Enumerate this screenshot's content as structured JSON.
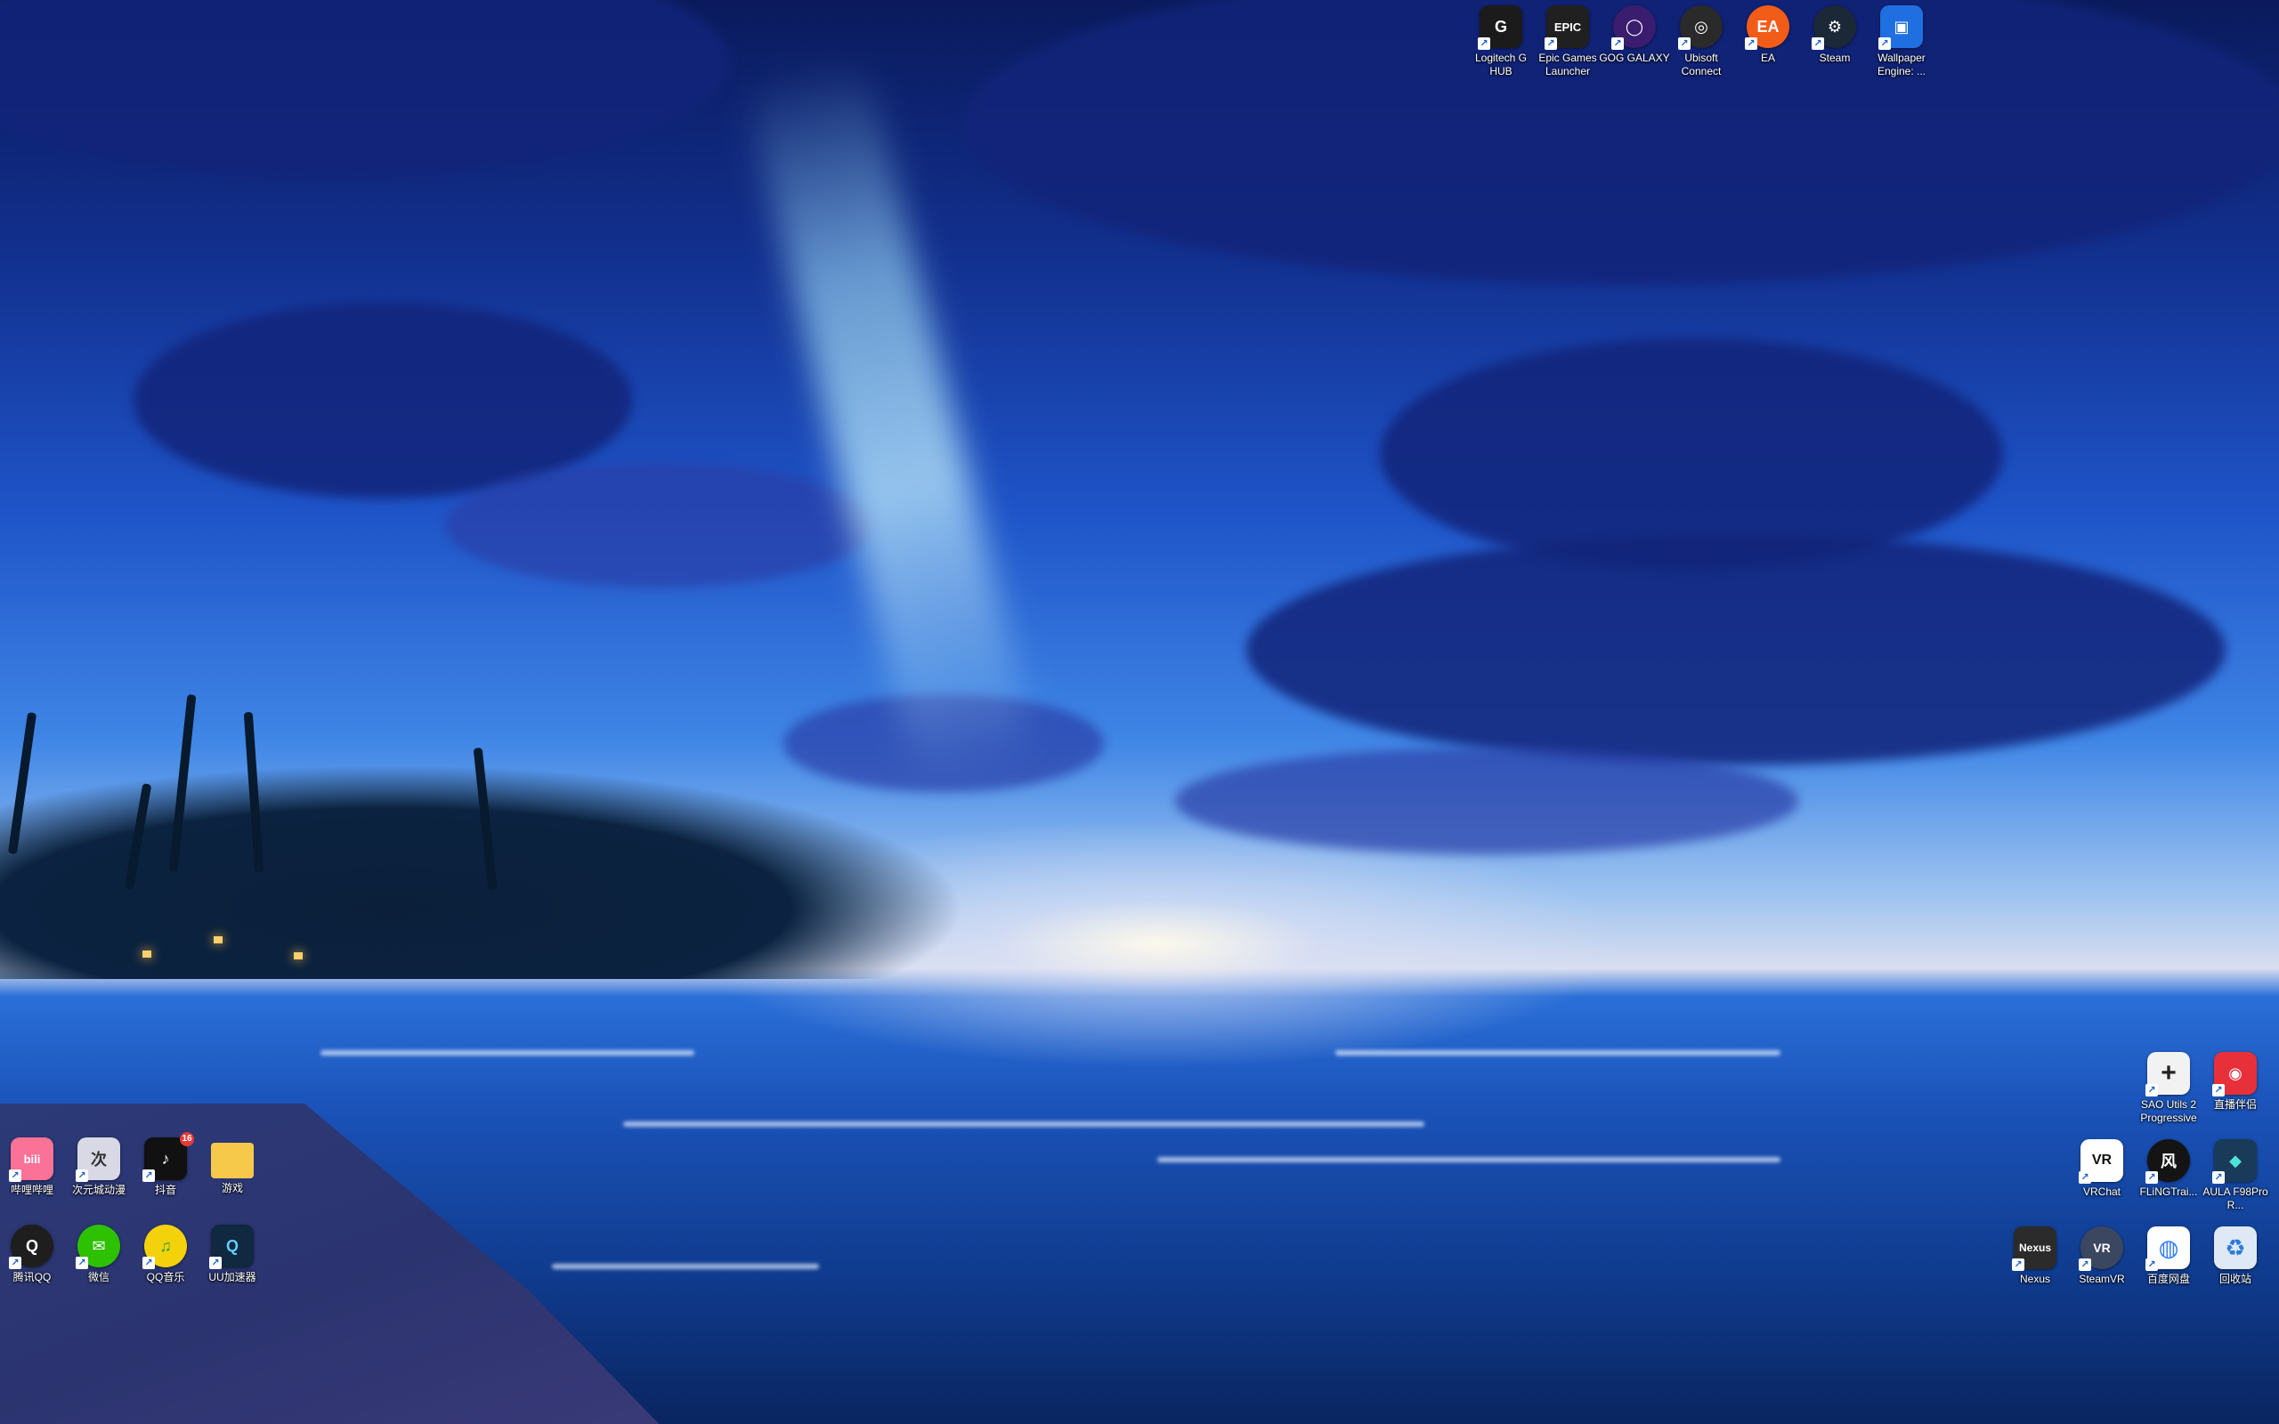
{
  "desktop": {
    "top_icons": [
      {
        "label": "Logitech G HUB",
        "glyph": "G",
        "color": "#1b1b1b",
        "icon": "logitech-g-hub-icon"
      },
      {
        "label": "Epic Games Launcher",
        "glyph": "EPIC",
        "color": "#202020",
        "icon": "epic-games-icon"
      },
      {
        "label": "GOG GALAXY",
        "glyph": "◯",
        "color": "#3a1d6e",
        "icon": "gog-galaxy-icon"
      },
      {
        "label": "Ubisoft Connect",
        "glyph": "◎",
        "color": "#2a2a2a",
        "icon": "ubisoft-connect-icon"
      },
      {
        "label": "EA",
        "glyph": "EA",
        "color": "#f25c19",
        "icon": "ea-icon"
      },
      {
        "label": "Steam",
        "glyph": "⚙",
        "color": "#1b2838",
        "icon": "steam-icon"
      },
      {
        "label": "Wallpaper Engine: ...",
        "glyph": "▣",
        "color": "#1f6fe0",
        "icon": "wallpaper-engine-icon"
      }
    ],
    "left_icons_row1": [
      {
        "label": "哔哩哔哩",
        "glyph": "bili",
        "color": "#fb7299",
        "icon": "bilibili-icon"
      },
      {
        "label": "次元城动漫",
        "glyph": "次",
        "color": "#d9d9e6",
        "icon": "ciyuancheng-icon"
      },
      {
        "label": "抖音",
        "glyph": "♪",
        "color": "#111111",
        "icon": "douyin-icon",
        "badge": "16"
      },
      {
        "label": "游戏",
        "glyph": "",
        "color": "#f6c94a",
        "icon": "folder-icon"
      }
    ],
    "left_icons_row2": [
      {
        "label": "腾讯QQ",
        "glyph": "Q",
        "color": "#1e1e1e",
        "icon": "qq-icon"
      },
      {
        "label": "微信",
        "glyph": "✉",
        "color": "#2dc100",
        "icon": "wechat-icon"
      },
      {
        "label": "QQ音乐",
        "glyph": "♫",
        "color": "#f4d20b",
        "icon": "qq-music-icon"
      },
      {
        "label": "UU加速器",
        "glyph": "Q",
        "color": "#102840",
        "icon": "uu-booster-icon"
      }
    ],
    "right_icons_row1": [
      {
        "label": "SAO Utils 2 Progressive",
        "glyph": "+",
        "color": "#f2f2f2",
        "icon": "sao-utils-icon"
      },
      {
        "label": "直播伴侣",
        "glyph": "◉",
        "color": "#e8303a",
        "icon": "live-companion-icon"
      }
    ],
    "right_icons_row2": [
      {
        "label": "VRChat",
        "glyph": "VR",
        "color": "#ffffff",
        "icon": "vrchat-icon"
      },
      {
        "label": "FLiNGTrai...",
        "glyph": "风",
        "color": "#141414",
        "icon": "fling-trainer-icon"
      },
      {
        "label": "AULA F98Pro R...",
        "glyph": "◆",
        "color": "#1a3a5a",
        "icon": "aula-keyboard-icon"
      }
    ],
    "right_icons_row3": [
      {
        "label": "Nexus",
        "glyph": "Nexus",
        "color": "#2b2b2b",
        "icon": "nexus-icon"
      },
      {
        "label": "SteamVR",
        "glyph": "VR",
        "color": "#3b4660",
        "icon": "steamvr-icon"
      },
      {
        "label": "百度网盘",
        "glyph": "◍",
        "color": "#ffffff",
        "icon": "baidu-netdisk-icon"
      },
      {
        "label": "回收站",
        "glyph": "♻",
        "color": "#dfe8f5",
        "icon": "recycle-bin-icon"
      }
    ]
  }
}
